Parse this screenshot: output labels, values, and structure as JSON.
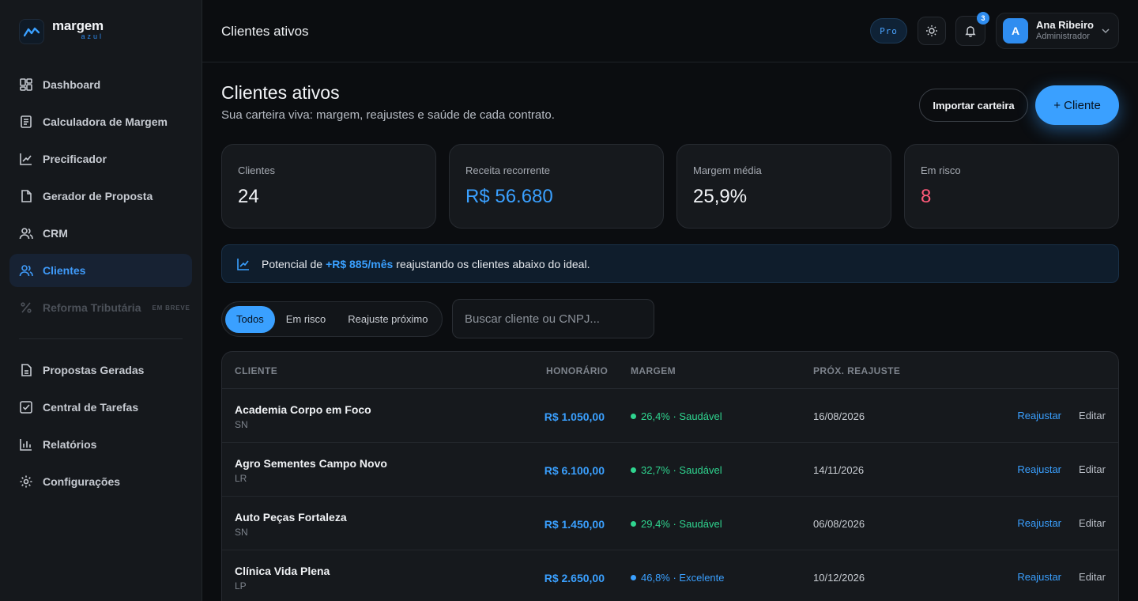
{
  "app": {
    "name": "margem",
    "sub": "azul"
  },
  "sidebar": {
    "items": [
      {
        "label": "Dashboard",
        "icon": "dashboard-icon"
      },
      {
        "label": "Calculadora de Margem",
        "icon": "calculator-icon"
      },
      {
        "label": "Precificador",
        "icon": "line-chart-icon"
      },
      {
        "label": "Gerador de Proposta",
        "icon": "document-icon"
      },
      {
        "label": "CRM",
        "icon": "users-icon"
      },
      {
        "label": "Clientes",
        "icon": "users-icon",
        "active": true
      },
      {
        "label": "Reforma Tributária",
        "icon": "percent-icon",
        "badge": "EM BREVE",
        "disabled": true
      }
    ],
    "secondary": [
      {
        "label": "Propostas Geradas",
        "icon": "file-text-icon"
      },
      {
        "label": "Central de Tarefas",
        "icon": "checkbox-icon"
      },
      {
        "label": "Relatórios",
        "icon": "bar-chart-icon"
      },
      {
        "label": "Configurações",
        "icon": "gear-icon"
      }
    ]
  },
  "header": {
    "title": "Clientes ativos",
    "plan_badge": "Pro",
    "notifications": "3",
    "user": {
      "initial": "A",
      "name": "Ana Ribeiro",
      "role": "Administrador"
    }
  },
  "page": {
    "title": "Clientes ativos",
    "subtitle": "Sua carteira viva: margem, reajustes e saúde de cada contrato.",
    "import_button": "Importar carteira",
    "new_button": "+ Cliente"
  },
  "stats": [
    {
      "label": "Clientes",
      "value": "24"
    },
    {
      "label": "Receita recorrente",
      "value": "R$ 56.680"
    },
    {
      "label": "Margem média",
      "value": "25,9%"
    },
    {
      "label": "Em risco",
      "value": "8"
    }
  ],
  "banner": {
    "prefix": "Potencial de",
    "highlight": "+R$ 885/mês",
    "suffix": "reajustando os clientes abaixo do ideal."
  },
  "filters": [
    "Todos",
    "Em risco",
    "Reajuste próximo"
  ],
  "search": {
    "placeholder": "Buscar cliente ou CNPJ..."
  },
  "table": {
    "headers": {
      "client": "CLIENTE",
      "fee": "HONORÁRIO",
      "margin": "MARGEM",
      "next": "PRÓX. REAJUSTE"
    },
    "rows": [
      {
        "name": "Academia Corpo em Foco",
        "regime": "SN",
        "fee": "R$ 1.050,00",
        "margin": "26,4% · Saudável",
        "status_color": "#2fd48f",
        "date": "16/08/2026",
        "adjust": "Reajustar",
        "edit": "Editar"
      },
      {
        "name": "Agro Sementes Campo Novo",
        "regime": "LR",
        "fee": "R$ 6.100,00",
        "margin": "32,7% · Saudável",
        "status_color": "#2fd48f",
        "date": "14/11/2026",
        "adjust": "Reajustar",
        "edit": "Editar"
      },
      {
        "name": "Auto Peças Fortaleza",
        "regime": "SN",
        "fee": "R$ 1.450,00",
        "margin": "29,4% · Saudável",
        "status_color": "#2fd48f",
        "date": "06/08/2026",
        "adjust": "Reajustar",
        "edit": "Editar"
      },
      {
        "name": "Clínica Vida Plena",
        "regime": "LP",
        "fee": "R$ 2.650,00",
        "margin": "46,8% · Excelente",
        "status_color": "#3aa0ff",
        "date": "10/12/2026",
        "adjust": "Reajustar",
        "edit": "Editar"
      }
    ]
  }
}
